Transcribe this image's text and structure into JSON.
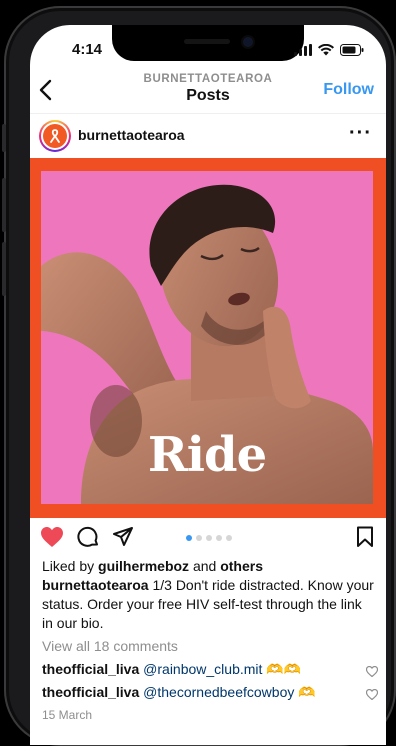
{
  "status": {
    "time": "4:14"
  },
  "nav": {
    "account": "BURNETTAOTEAROA",
    "title": "Posts",
    "follow": "Follow"
  },
  "post": {
    "username": "burnettaotearoa",
    "image_word": "Ride",
    "carousel": {
      "count": 5,
      "active": 1
    },
    "liked_by_prefix": "Liked by ",
    "liked_by_user": "guilhermeboz",
    "liked_by_mid": " and ",
    "liked_by_others": "others",
    "caption_user": "burnettaotearoa",
    "caption_text": " 1/3 Don't ride distracted. Know your status. Order your free HIV self-test through the link in our bio.",
    "view_comments": "View all 18 comments",
    "comments": [
      {
        "user": "theofficial_liva",
        "mention": "@rainbow_club.mit",
        "emoji": "🫶🫶"
      },
      {
        "user": "theofficial_liva",
        "mention": "@thecornedbeefcowboy",
        "emoji": "🫶"
      }
    ],
    "date": "15 March"
  },
  "colors": {
    "accent": "#3897f0",
    "like": "#ed4956",
    "brand": "#f04e23",
    "photo_bg": "#ee76bd"
  },
  "icons": [
    "back-chevron-icon",
    "more-icon",
    "heart-icon",
    "comment-icon",
    "share-icon",
    "bookmark-icon",
    "wifi-icon",
    "battery-icon",
    "signal-icon"
  ]
}
